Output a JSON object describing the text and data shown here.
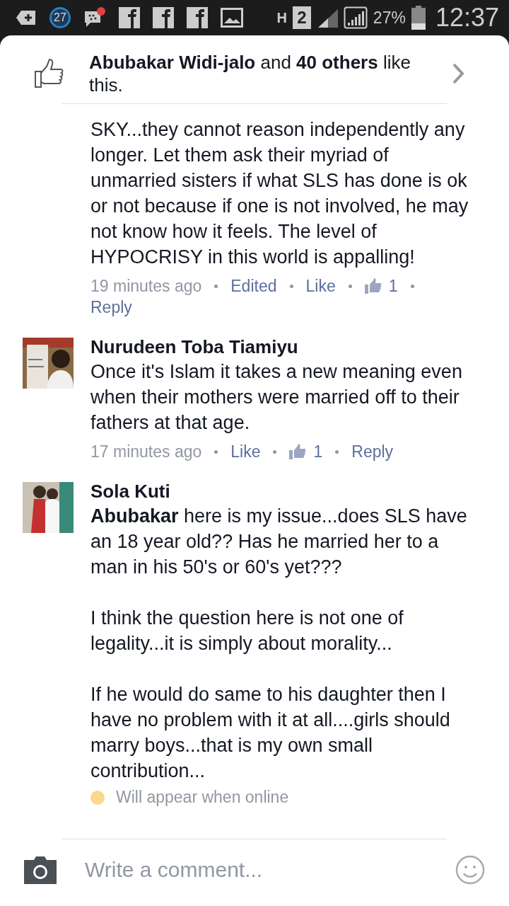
{
  "status_bar": {
    "notification_count": "27",
    "network_type": "H",
    "sim_slot": "2",
    "battery": "27%",
    "time": "12:37"
  },
  "likes_bar": {
    "text": "**Abubakar Widi-jalo** and **40 others** like this."
  },
  "comments": [
    {
      "text": "SKY...they cannot reason independently any longer. Let them ask their myriad of unmarried sisters if what SLS has done is ok or not because if one is not involved, he may not know how it feels. The level of HYPOCRISY in this world is appalling!",
      "meta": [
        {
          "kind": "time",
          "text": "19 minutes ago"
        },
        {
          "kind": "link",
          "text": "Edited"
        },
        {
          "kind": "link",
          "text": "Like"
        },
        {
          "kind": "likes",
          "text": "1"
        },
        {
          "kind": "link",
          "text": "Reply"
        }
      ]
    },
    {
      "author": "Nurudeen Toba Tiamiyu",
      "avatar": {
        "kind": "picture"
      },
      "text": "Once it's Islam it takes a new meaning even when  their mothers were married off to their fathers at that age.",
      "meta": [
        {
          "kind": "time",
          "text": "17 minutes ago"
        },
        {
          "kind": "link",
          "text": "Like"
        },
        {
          "kind": "likes",
          "text": "1"
        },
        {
          "kind": "link",
          "text": "Reply"
        }
      ]
    },
    {
      "author": "Sola Kuti",
      "avatar": {
        "kind": "picture"
      },
      "text": "**Abubakar** here is my issue...does SLS have an 18 year old?? Has he married her to a man in his 50's or 60's yet???\n\nI think the question here is not one of legality...it is simply about morality...\n\nIf he would do same to his daughter then I have no problem with it at all....girls should marry boys...that is my own small contribution...",
      "pending": {
        "text": "Will appear when online",
        "color": "#fad88c"
      }
    }
  ],
  "composer": {
    "placeholder": "Write a comment..."
  }
}
